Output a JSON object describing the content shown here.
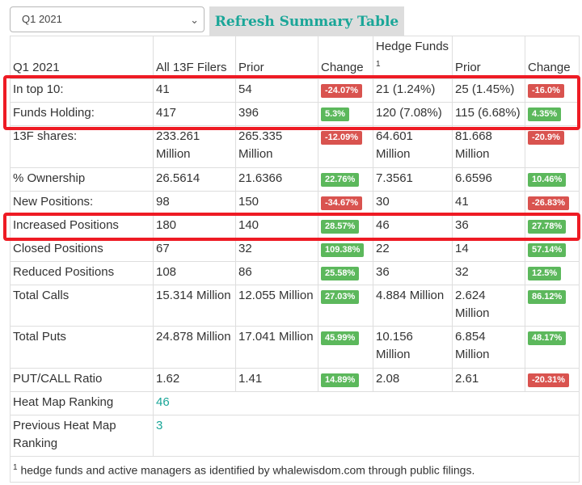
{
  "controls": {
    "quarter_select": "Q1 2021",
    "refresh_button": "Refresh Summary Table"
  },
  "table": {
    "headers": {
      "period": "Q1 2021",
      "all_filers": "All 13F Filers",
      "prior": "Prior",
      "change": "Change",
      "hedge_funds": "Hedge Funds",
      "hedge_funds_note": "1",
      "hf_prior": "Prior",
      "hf_change": "Change"
    },
    "rows": [
      {
        "label": "In top 10:",
        "all": "41",
        "prior": "54",
        "change": "-24.07%",
        "change_dir": "down",
        "hf": "21 (1.24%)",
        "hf_prior": "25 (1.45%)",
        "hf_change": "-16.0%",
        "hf_change_dir": "down"
      },
      {
        "label": "Funds Holding:",
        "all": "417",
        "prior": "396",
        "change": "5.3%",
        "change_dir": "up",
        "hf": "120 (7.08%)",
        "hf_prior": "115 (6.68%)",
        "hf_change": "4.35%",
        "hf_change_dir": "up"
      },
      {
        "label": "13F shares:",
        "all": "233.261 Million",
        "prior": "265.335 Million",
        "change": "-12.09%",
        "change_dir": "down",
        "hf": "64.601 Million",
        "hf_prior": "81.668 Million",
        "hf_change": "-20.9%",
        "hf_change_dir": "down"
      },
      {
        "label": "% Ownership",
        "all": "26.5614",
        "prior": "21.6366",
        "change": "22.76%",
        "change_dir": "up",
        "hf": "7.3561",
        "hf_prior": "6.6596",
        "hf_change": "10.46%",
        "hf_change_dir": "up"
      },
      {
        "label": "New Positions:",
        "all": "98",
        "prior": "150",
        "change": "-34.67%",
        "change_dir": "down",
        "hf": "30",
        "hf_prior": "41",
        "hf_change": "-26.83%",
        "hf_change_dir": "down"
      },
      {
        "label": "Increased Positions",
        "all": "180",
        "prior": "140",
        "change": "28.57%",
        "change_dir": "up",
        "hf": "46",
        "hf_prior": "36",
        "hf_change": "27.78%",
        "hf_change_dir": "up"
      },
      {
        "label": "Closed Positions",
        "all": "67",
        "prior": "32",
        "change": "109.38%",
        "change_dir": "up",
        "hf": "22",
        "hf_prior": "14",
        "hf_change": "57.14%",
        "hf_change_dir": "up"
      },
      {
        "label": "Reduced Positions",
        "all": "108",
        "prior": "86",
        "change": "25.58%",
        "change_dir": "up",
        "hf": "36",
        "hf_prior": "32",
        "hf_change": "12.5%",
        "hf_change_dir": "up"
      },
      {
        "label": "Total Calls",
        "all": "15.314 Million",
        "prior": "12.055 Million",
        "change": "27.03%",
        "change_dir": "up",
        "hf": "4.884 Million",
        "hf_prior": "2.624 Million",
        "hf_change": "86.12%",
        "hf_change_dir": "up"
      },
      {
        "label": "Total Puts",
        "all": "24.878 Million",
        "prior": "17.041 Million",
        "change": "45.99%",
        "change_dir": "up",
        "hf": "10.156 Million",
        "hf_prior": "6.854 Million",
        "hf_change": "48.17%",
        "hf_change_dir": "up"
      },
      {
        "label": "PUT/CALL Ratio",
        "all": "1.62",
        "prior": "1.41",
        "change": "14.89%",
        "change_dir": "up",
        "hf": "2.08",
        "hf_prior": "2.61",
        "hf_change": "-20.31%",
        "hf_change_dir": "down"
      }
    ],
    "heat_map": {
      "label": "Heat Map Ranking",
      "value": "46"
    },
    "prev_heat_map": {
      "label": "Previous Heat Map Ranking",
      "value": "3"
    },
    "footnote": {
      "marker": "1",
      "text": "hedge funds and active managers as identified by whalewisdom.com through public filings."
    }
  },
  "colors": {
    "up": "#5cb85c",
    "down": "#d9534f",
    "accent": "#1aa698",
    "highlight": "#ee1b24"
  }
}
